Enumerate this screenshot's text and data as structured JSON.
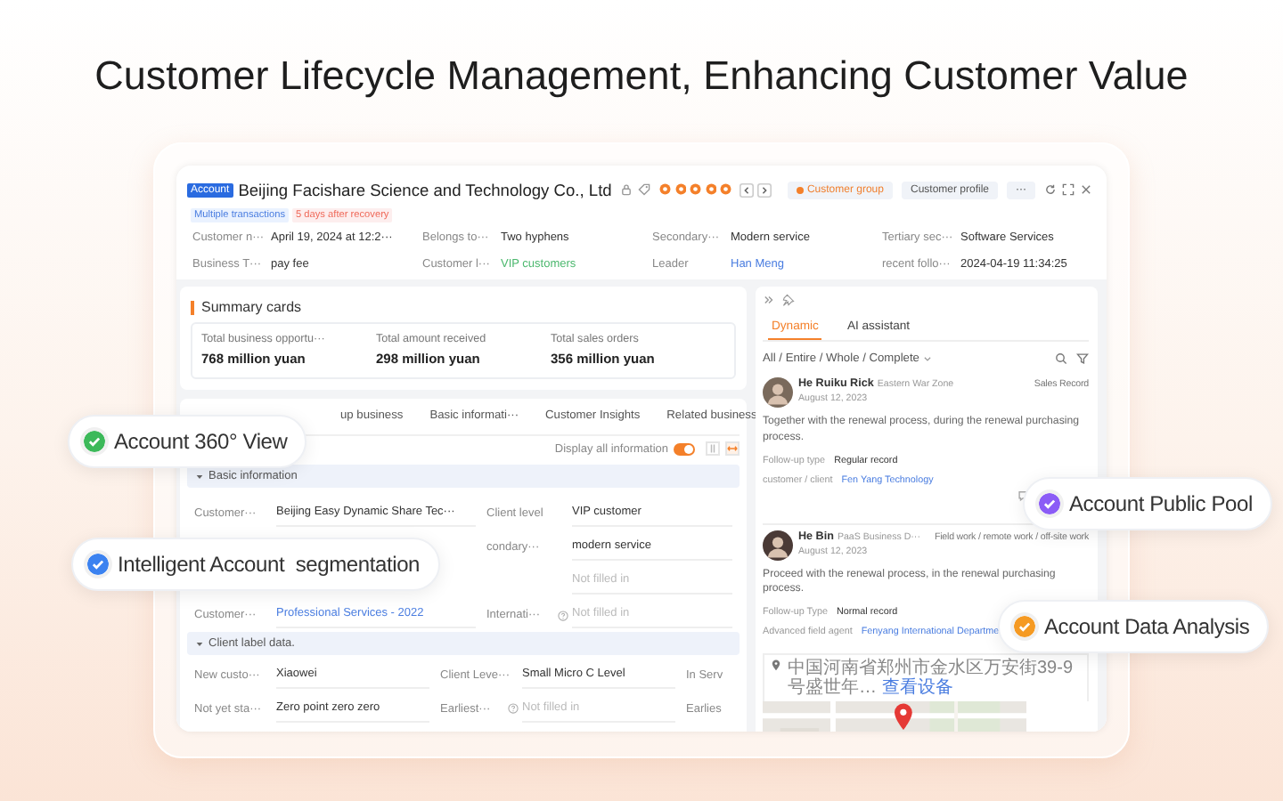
{
  "headline": "Customer Lifecycle Management, Enhancing Customer Value",
  "record": {
    "badge": "Account",
    "title": "Beijing Facishare Science and Technology Co., Ltd",
    "actions": [
      {
        "label": "Customer group",
        "kind": "group"
      },
      {
        "label": "Customer profile",
        "kind": "plain"
      },
      {
        "label": "···",
        "kind": "plain"
      }
    ],
    "tags": [
      {
        "text": "Multiple transactions",
        "kind": "info"
      },
      {
        "text": "5 days after recovery",
        "kind": "warn"
      }
    ],
    "fields": [
      {
        "label": "Customer n···",
        "value": "April 19, 2024 at 12:2···",
        "kind": "plain"
      },
      {
        "label": "Belongs to···",
        "value": "Two hyphens",
        "kind": "plain"
      },
      {
        "label": "Secondary···",
        "value": "Modern service",
        "kind": "plain"
      },
      {
        "label": "Tertiary sec···",
        "value": "Software Services",
        "kind": "plain"
      },
      {
        "label": "Business T···",
        "value": "pay fee",
        "kind": "plain"
      },
      {
        "label": "Customer l···",
        "value": "VIP customers",
        "kind": "status"
      },
      {
        "label": "Leader",
        "value": "Han Meng",
        "kind": "link"
      },
      {
        "label": "recent follo···",
        "value": "2024-04-19 11:34:25",
        "kind": "plain"
      }
    ]
  },
  "summary": {
    "title": "Summary cards",
    "stats": [
      {
        "label": "Total business opportu···",
        "value": "768 million yuan"
      },
      {
        "label": "Total amount received",
        "value": "298 million yuan"
      },
      {
        "label": "Total sales orders",
        "value": "356 million yuan"
      }
    ]
  },
  "detail": {
    "tabs": [
      {
        "label": "up business",
        "selected": false
      },
      {
        "label": "Basic informati···",
        "selected": false
      },
      {
        "label": "Customer Insights",
        "selected": false
      },
      {
        "label": "Related business",
        "selected": false
      }
    ],
    "display_all": {
      "label": "Display all information",
      "on": true
    },
    "sections": [
      {
        "title": "Basic information",
        "expanded": true,
        "kind": "pairs",
        "rows": [
          {
            "kind": "full",
            "fields": [
              {
                "label": "Customer···",
                "value": "Beijing Easy Dynamic Share Tec···",
                "kind": "plain",
                "help": false
              },
              {
                "label": "Client level",
                "value": "VIP customer",
                "kind": "plain",
                "help": false
              }
            ]
          },
          {
            "kind": "partial",
            "fields": [
              {
                "label": "condary···",
                "value": "modern service",
                "kind": "plain",
                "help": false
              }
            ]
          },
          {
            "kind": "partial",
            "fields": [
              {
                "placeholder": "Not filled in",
                "help": false
              }
            ]
          },
          {
            "kind": "full",
            "fields": [
              {
                "label": "Customer···",
                "value": "Professional Services - 2022",
                "kind": "link",
                "help": false
              },
              {
                "label": "Internati···",
                "placeholder": "Not filled in",
                "help": true
              }
            ]
          }
        ]
      },
      {
        "title": "Client label data.",
        "expanded": true,
        "kind": "triples",
        "rows": [
          {
            "kind": "full",
            "fields": [
              {
                "label": "New custo···",
                "value": "Xiaowei",
                "kind": "plain",
                "help": false
              },
              {
                "label": "Client Leve···",
                "value": "Small Micro C Level",
                "kind": "plain",
                "help": false
              },
              {
                "label": "In Serv"
              }
            ]
          },
          {
            "kind": "full",
            "fields": [
              {
                "label": "Not yet sta···",
                "value": "Zero point zero zero",
                "kind": "plain",
                "help": false
              },
              {
                "label": "Earliest···",
                "placeholder": "Not filled in",
                "help": true
              },
              {
                "label": "Earlies"
              }
            ]
          }
        ]
      }
    ]
  },
  "feed": {
    "tabs": [
      {
        "label": "Dynamic",
        "selected": true
      },
      {
        "label": "AI assistant",
        "selected": false
      }
    ],
    "filter": "All / Entire / Whole / Complete",
    "items": [
      {
        "name": "He Ruiku Rick",
        "unit": "Eastern War Zone",
        "type": "Sales Record",
        "date": "August 12, 2023",
        "text": "Together with the renewal process, during the renewal purchasing process.",
        "details": [
          {
            "label": "Follow-up type",
            "value": "Regular record",
            "kind": "plain"
          },
          {
            "label": "customer / client",
            "value": "Fen Yang Technology",
            "kind": "link"
          }
        ]
      },
      {
        "name": "He Bin",
        "unit": "PaaS Business D···",
        "type": "Field work / remote work / off-site work",
        "date": "August 12, 2023",
        "text": "Proceed with the renewal process, in the renewal purchasing process.",
        "details": [
          {
            "label": "Follow-up Type",
            "value": "Normal record",
            "kind": "plain"
          },
          {
            "label": "Advanced field agent",
            "value": "Fenyang International Departme",
            "kind": "link"
          }
        ],
        "address": "中国河南省郑州市金水区万安街39-9号盛世年…",
        "address_link": "查看设备",
        "map": {
          "kind": "picture"
        }
      }
    ]
  },
  "callouts": [
    {
      "text": "Account 360° View",
      "color": "#3cb95a"
    },
    {
      "text": "Intelligent Account  segmentation",
      "color": "#3b82f0"
    },
    {
      "text": "Account Public Pool",
      "color": "#8b5cf6"
    },
    {
      "text": "Account Data Analysis",
      "color": "#f59a23"
    }
  ]
}
